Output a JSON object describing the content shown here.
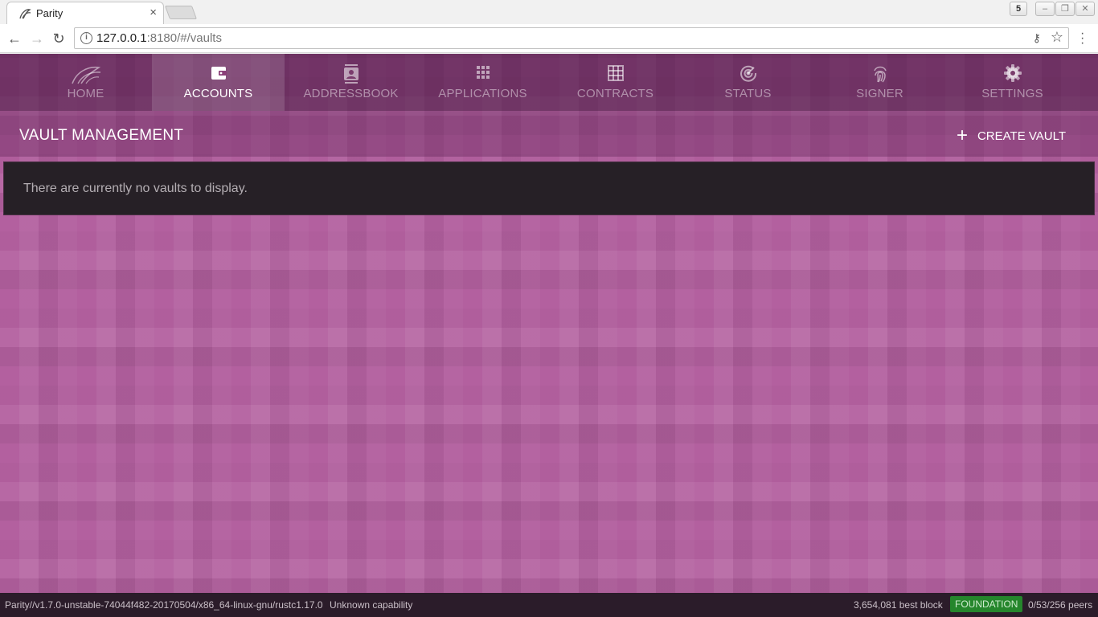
{
  "browser": {
    "tab_title": "Parity",
    "tab_close": "×",
    "profile_badge": "5",
    "url_host": "127.0.0.1",
    "url_rest": ":8180/#/vaults"
  },
  "nav": {
    "items": [
      {
        "label": "HOME",
        "icon": "parity-logo-icon"
      },
      {
        "label": "ACCOUNTS",
        "icon": "wallet-icon",
        "active": true
      },
      {
        "label": "ADDRESSBOOK",
        "icon": "contact-card-icon"
      },
      {
        "label": "APPLICATIONS",
        "icon": "grid-dots-icon"
      },
      {
        "label": "CONTRACTS",
        "icon": "table-grid-icon"
      },
      {
        "label": "STATUS",
        "icon": "radar-icon"
      },
      {
        "label": "SIGNER",
        "icon": "fingerprint-icon"
      },
      {
        "label": "SETTINGS",
        "icon": "gear-icon"
      }
    ]
  },
  "header": {
    "title": "VAULT MANAGEMENT",
    "create_label": "CREATE VAULT",
    "create_icon": "+"
  },
  "main": {
    "empty_message": "There are currently no vaults to display."
  },
  "status": {
    "version": "Parity//v1.7.0-unstable-74044f482-20170504/x86_64-linux-gnu/rustc1.17.0",
    "capability": "Unknown capability",
    "best_block": "3,654,081 best block",
    "chain": "FOUNDATION",
    "peers": "0/53/256 peers"
  },
  "colors": {
    "accent_purple": "#b3609f",
    "chain_badge": "#25862c"
  }
}
